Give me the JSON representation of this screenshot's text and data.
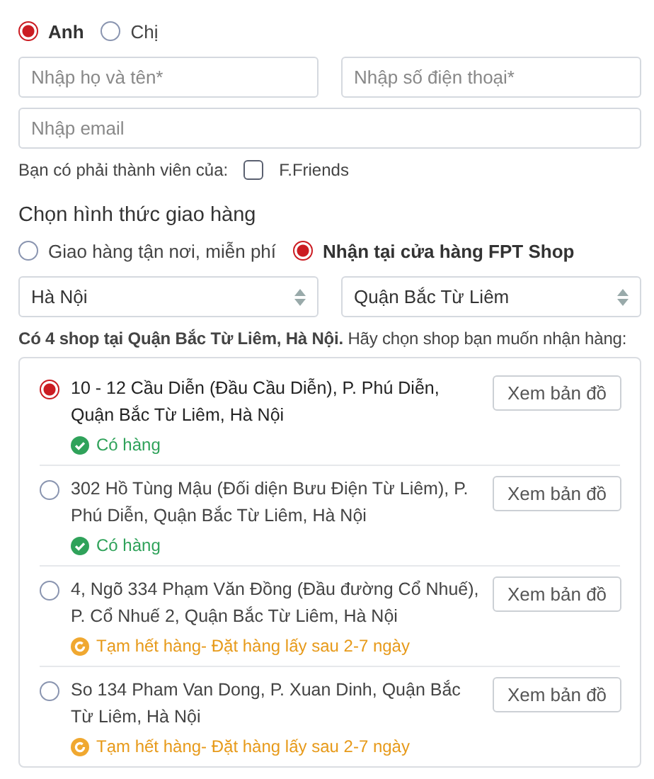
{
  "gender": [
    {
      "label": "Anh",
      "selected": true
    },
    {
      "label": "Chị",
      "selected": false
    }
  ],
  "fields": {
    "name": {
      "placeholder": "Nhập họ và tên*"
    },
    "phone": {
      "placeholder": "Nhập số điện thoại*"
    },
    "email": {
      "placeholder": "Nhập email"
    }
  },
  "membership": {
    "label": "Bạn có phải thành viên của:",
    "option": "F.Friends",
    "checked": false
  },
  "delivery": {
    "heading": "Chọn hình thức giao hàng",
    "options": [
      {
        "label": "Giao hàng tận nơi, miễn phí",
        "selected": false
      },
      {
        "label": "Nhận tại cửa hàng FPT Shop",
        "selected": true
      }
    ],
    "city": "Hà Nội",
    "district": "Quận Bắc Từ Liêm",
    "info": "**Có 4 shop tại Quận Bắc Từ Liêm, Hà Nội.** Hãy chọn shop bạn muốn nhận hàng:",
    "shops": [
      {
        "address": "10 - 12 Cầu Diễn (Đầu Cầu Diễn), P. Phú Diễn, Quận Bắc Từ Liêm, Hà Nội",
        "selected": true,
        "kind": "in_stock",
        "status": "Có hàng",
        "map_button": "Xem bản đồ"
      },
      {
        "address": "302 Hồ Tùng Mậu (Đối diện Bưu Điện Từ Liêm), P. Phú Diễn, Quận Bắc Từ Liêm, Hà Nội",
        "selected": false,
        "kind": "in_stock",
        "status": "Có hàng",
        "map_button": "Xem bản đồ"
      },
      {
        "address": "4, Ngõ 334 Phạm Văn Đồng (Đầu đường Cổ Nhuế), P. Cổ Nhuế 2, Quận Bắc Từ Liêm, Hà Nội",
        "selected": false,
        "kind": "out_of_stock",
        "status": "Tạm hết hàng- Đặt hàng lấy sau 2-7 ngày",
        "map_button": "Xem bản đồ"
      },
      {
        "address": "So 134 Pham Van Dong, P. Xuan Dinh, Quận Bắc Từ Liêm, Hà Nội",
        "selected": false,
        "kind": "out_of_stock",
        "status": "Tạm hết hàng- Đặt hàng lấy sau 2-7 ngày",
        "map_button": "Xem bản đồ"
      }
    ]
  }
}
